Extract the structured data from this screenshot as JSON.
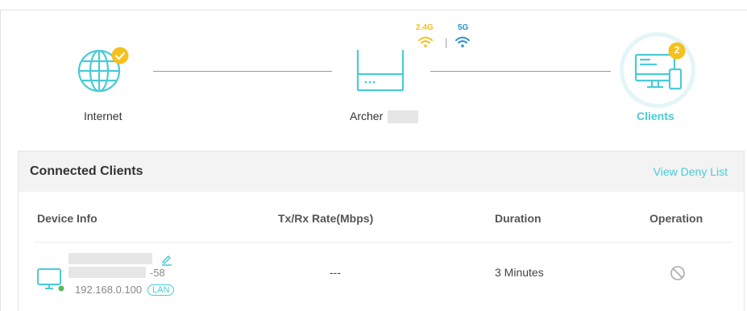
{
  "topology": {
    "internet": {
      "label": "Internet",
      "icon": "globe-icon",
      "status_icon": "check-badge-icon"
    },
    "router": {
      "label": "Archer",
      "icon": "router-icon"
    },
    "bands": {
      "band_24": "2.4G",
      "band_5": "5G",
      "separator": "|"
    },
    "clients": {
      "label": "Clients",
      "count": "2",
      "icon": "clients-icon"
    }
  },
  "panel": {
    "title": "Connected Clients",
    "deny_link": "View Deny List",
    "columns": {
      "device": "Device Info",
      "rate": "Tx/Rx Rate(Mbps)",
      "duration": "Duration",
      "operation": "Operation"
    },
    "rows": [
      {
        "mac_suffix": "-58",
        "ip": "192.168.0.100",
        "type_badge": "LAN",
        "rate": "---",
        "duration": "3 Minutes",
        "operation_icon": "block-icon"
      }
    ]
  },
  "colors": {
    "accent": "#4acbd6",
    "check": "#f5c11c",
    "wifi_24": "#f5c11c",
    "wifi_5": "#2b93c7",
    "online": "#5cb85c"
  }
}
